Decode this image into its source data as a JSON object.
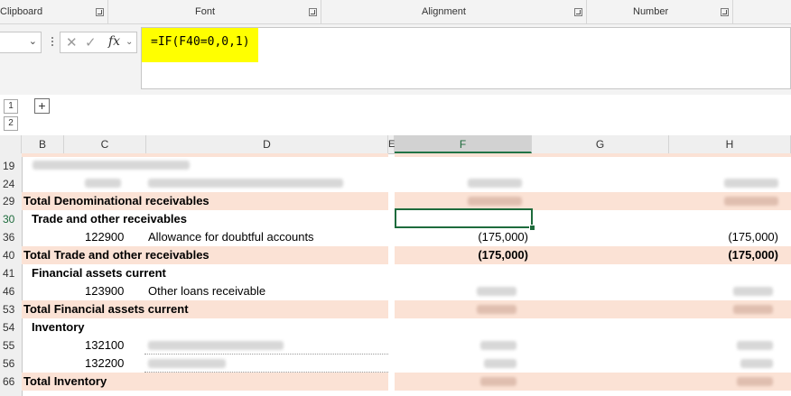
{
  "ribbon": {
    "groups": [
      "Clipboard",
      "Font",
      "Alignment",
      "Number"
    ]
  },
  "formula_bar": {
    "formula": "=IF(F40=0,0,1)",
    "fx": "fx",
    "cancel_icon": "cancel-icon",
    "enter_icon": "check-icon"
  },
  "outline": {
    "levels": [
      "1",
      "2"
    ],
    "expand": "+"
  },
  "columns": [
    "B",
    "C",
    "D",
    "E",
    "F",
    "G",
    "H"
  ],
  "selected_column": "F",
  "rows": {
    "r19": {
      "num": "19"
    },
    "r24": {
      "num": "24"
    },
    "r29": {
      "num": "29",
      "label": "Total Denominational receivables"
    },
    "r30": {
      "num": "30",
      "label": "Trade and other receivables"
    },
    "r36": {
      "num": "36",
      "code": "122900",
      "desc": "Allowance for doubtful accounts",
      "f": "(175,000)",
      "h": "(175,000)"
    },
    "r40": {
      "num": "40",
      "label": "Total Trade and other receivables",
      "f": "(175,000)",
      "h": "(175,000)"
    },
    "r41": {
      "num": "41",
      "label": "Financial assets current"
    },
    "r46": {
      "num": "46",
      "code": "123900",
      "desc": "Other loans  receivable"
    },
    "r53": {
      "num": "53",
      "label": "Total Financial assets current"
    },
    "r54": {
      "num": "54",
      "label": "Inventory"
    },
    "r55": {
      "num": "55",
      "code": "132100"
    },
    "r56": {
      "num": "56",
      "code": "132200"
    },
    "r66": {
      "num": "66",
      "label": "Total Inventory"
    }
  },
  "selected_row": "30",
  "colors": {
    "total_fill": "#fbe2d5",
    "selection": "#217346",
    "formula_highlight": "#ffff00"
  }
}
